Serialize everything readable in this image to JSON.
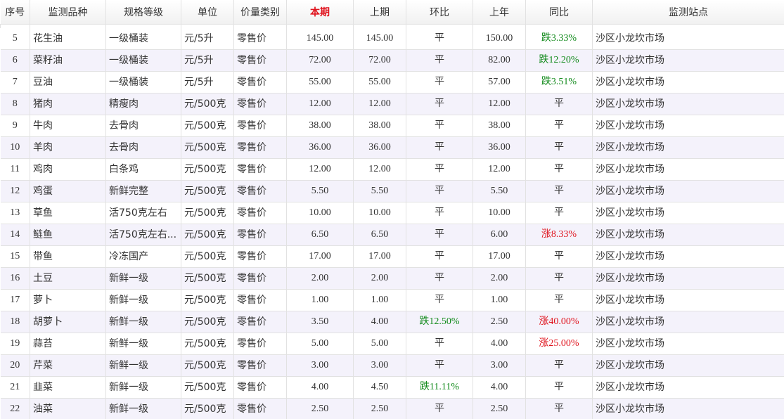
{
  "columns": [
    "序号",
    "监测品种",
    "规格等级",
    "单位",
    "价量类别",
    "本期",
    "上期",
    "环比",
    "上年",
    "同比",
    "监测站点"
  ],
  "rows": [
    {
      "no": "5",
      "name": "花生油",
      "spec": "一级桶装",
      "unit": "元/5升",
      "category": "零售价",
      "current": "145.00",
      "previous": "145.00",
      "mom": "平",
      "mom_trend": "flat",
      "last_year": "150.00",
      "yoy": "跌3.33%",
      "yoy_trend": "down",
      "station": "沙区小龙坎市场"
    },
    {
      "no": "6",
      "name": "菜籽油",
      "spec": "一级桶装",
      "unit": "元/5升",
      "category": "零售价",
      "current": "72.00",
      "previous": "72.00",
      "mom": "平",
      "mom_trend": "flat",
      "last_year": "82.00",
      "yoy": "跌12.20%",
      "yoy_trend": "down",
      "station": "沙区小龙坎市场"
    },
    {
      "no": "7",
      "name": "豆油",
      "spec": "一级桶装",
      "unit": "元/5升",
      "category": "零售价",
      "current": "55.00",
      "previous": "55.00",
      "mom": "平",
      "mom_trend": "flat",
      "last_year": "57.00",
      "yoy": "跌3.51%",
      "yoy_trend": "down",
      "station": "沙区小龙坎市场"
    },
    {
      "no": "8",
      "name": "猪肉",
      "spec": "精瘦肉",
      "unit": "元/500克",
      "category": "零售价",
      "current": "12.00",
      "previous": "12.00",
      "mom": "平",
      "mom_trend": "flat",
      "last_year": "12.00",
      "yoy": "平",
      "yoy_trend": "flat",
      "station": "沙区小龙坎市场"
    },
    {
      "no": "9",
      "name": "牛肉",
      "spec": "去骨肉",
      "unit": "元/500克",
      "category": "零售价",
      "current": "38.00",
      "previous": "38.00",
      "mom": "平",
      "mom_trend": "flat",
      "last_year": "38.00",
      "yoy": "平",
      "yoy_trend": "flat",
      "station": "沙区小龙坎市场"
    },
    {
      "no": "10",
      "name": "羊肉",
      "spec": "去骨肉",
      "unit": "元/500克",
      "category": "零售价",
      "current": "36.00",
      "previous": "36.00",
      "mom": "平",
      "mom_trend": "flat",
      "last_year": "36.00",
      "yoy": "平",
      "yoy_trend": "flat",
      "station": "沙区小龙坎市场"
    },
    {
      "no": "11",
      "name": "鸡肉",
      "spec": "白条鸡",
      "unit": "元/500克",
      "category": "零售价",
      "current": "12.00",
      "previous": "12.00",
      "mom": "平",
      "mom_trend": "flat",
      "last_year": "12.00",
      "yoy": "平",
      "yoy_trend": "flat",
      "station": "沙区小龙坎市场"
    },
    {
      "no": "12",
      "name": "鸡蛋",
      "spec": "新鲜完整",
      "unit": "元/500克",
      "category": "零售价",
      "current": "5.50",
      "previous": "5.50",
      "mom": "平",
      "mom_trend": "flat",
      "last_year": "5.50",
      "yoy": "平",
      "yoy_trend": "flat",
      "station": "沙区小龙坎市场"
    },
    {
      "no": "13",
      "name": "草鱼",
      "spec": "活750克左右",
      "unit": "元/500克",
      "category": "零售价",
      "current": "10.00",
      "previous": "10.00",
      "mom": "平",
      "mom_trend": "flat",
      "last_year": "10.00",
      "yoy": "平",
      "yoy_trend": "flat",
      "station": "沙区小龙坎市场"
    },
    {
      "no": "14",
      "name": "鲢鱼",
      "spec": "活750克左右...",
      "unit": "元/500克",
      "category": "零售价",
      "current": "6.50",
      "previous": "6.50",
      "mom": "平",
      "mom_trend": "flat",
      "last_year": "6.00",
      "yoy": "涨8.33%",
      "yoy_trend": "up",
      "station": "沙区小龙坎市场"
    },
    {
      "no": "15",
      "name": "带鱼",
      "spec": "冷冻国产",
      "unit": "元/500克",
      "category": "零售价",
      "current": "17.00",
      "previous": "17.00",
      "mom": "平",
      "mom_trend": "flat",
      "last_year": "17.00",
      "yoy": "平",
      "yoy_trend": "flat",
      "station": "沙区小龙坎市场"
    },
    {
      "no": "16",
      "name": "土豆",
      "spec": "新鲜一级",
      "unit": "元/500克",
      "category": "零售价",
      "current": "2.00",
      "previous": "2.00",
      "mom": "平",
      "mom_trend": "flat",
      "last_year": "2.00",
      "yoy": "平",
      "yoy_trend": "flat",
      "station": "沙区小龙坎市场"
    },
    {
      "no": "17",
      "name": "萝卜",
      "spec": "新鲜一级",
      "unit": "元/500克",
      "category": "零售价",
      "current": "1.00",
      "previous": "1.00",
      "mom": "平",
      "mom_trend": "flat",
      "last_year": "1.00",
      "yoy": "平",
      "yoy_trend": "flat",
      "station": "沙区小龙坎市场"
    },
    {
      "no": "18",
      "name": "胡萝卜",
      "spec": "新鲜一级",
      "unit": "元/500克",
      "category": "零售价",
      "current": "3.50",
      "previous": "4.00",
      "mom": "跌12.50%",
      "mom_trend": "down",
      "last_year": "2.50",
      "yoy": "涨40.00%",
      "yoy_trend": "up",
      "station": "沙区小龙坎市场"
    },
    {
      "no": "19",
      "name": "蒜苔",
      "spec": "新鲜一级",
      "unit": "元/500克",
      "category": "零售价",
      "current": "5.00",
      "previous": "5.00",
      "mom": "平",
      "mom_trend": "flat",
      "last_year": "4.00",
      "yoy": "涨25.00%",
      "yoy_trend": "up",
      "station": "沙区小龙坎市场"
    },
    {
      "no": "20",
      "name": "芹菜",
      "spec": "新鲜一级",
      "unit": "元/500克",
      "category": "零售价",
      "current": "3.00",
      "previous": "3.00",
      "mom": "平",
      "mom_trend": "flat",
      "last_year": "3.00",
      "yoy": "平",
      "yoy_trend": "flat",
      "station": "沙区小龙坎市场"
    },
    {
      "no": "21",
      "name": "韭菜",
      "spec": "新鲜一级",
      "unit": "元/500克",
      "category": "零售价",
      "current": "4.00",
      "previous": "4.50",
      "mom": "跌11.11%",
      "mom_trend": "down",
      "last_year": "4.00",
      "yoy": "平",
      "yoy_trend": "flat",
      "station": "沙区小龙坎市场"
    },
    {
      "no": "22",
      "name": "油菜",
      "spec": "新鲜一级",
      "unit": "元/500克",
      "category": "零售价",
      "current": "2.50",
      "previous": "2.50",
      "mom": "平",
      "mom_trend": "flat",
      "last_year": "2.50",
      "yoy": "平",
      "yoy_trend": "flat",
      "station": "沙区小龙坎市场"
    }
  ],
  "colors": {
    "down": "#118a1b",
    "up": "#e0141e",
    "current_header": "#e0141e",
    "stripe": "#f4f2fb",
    "border": "#e2e2e2"
  }
}
